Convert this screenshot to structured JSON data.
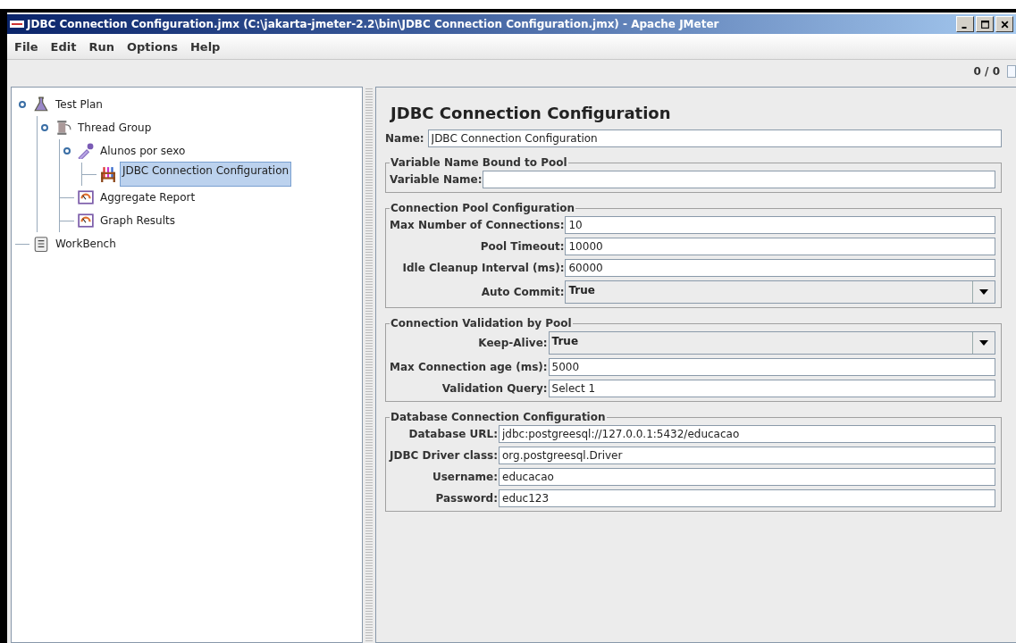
{
  "window": {
    "title": "JDBC Connection Configuration.jmx (C:\\jakarta-jmeter-2.2\\bin\\JDBC Connection Configuration.jmx) - Apache JMeter"
  },
  "menu": [
    {
      "label": "File"
    },
    {
      "label": "Edit"
    },
    {
      "label": "Run"
    },
    {
      "label": "Options"
    },
    {
      "label": "Help"
    }
  ],
  "toolbar": {
    "counter": "0 / 0"
  },
  "tree": [
    {
      "label": "Test Plan",
      "kind": "plan",
      "expanded": true,
      "selected": false,
      "children": [
        {
          "label": "Thread Group",
          "kind": "thread",
          "expanded": true,
          "selected": false,
          "children": [
            {
              "label": "Alunos por sexo",
              "kind": "sampler",
              "expanded": true,
              "selected": false,
              "children": [
                {
                  "label": "JDBC Connection Configuration",
                  "kind": "config",
                  "selected": true
                }
              ]
            },
            {
              "label": "Aggregate Report",
              "kind": "listener",
              "selected": false
            },
            {
              "label": "Graph Results",
              "kind": "listener",
              "selected": false
            }
          ]
        }
      ]
    },
    {
      "label": "WorkBench",
      "kind": "workbench",
      "selected": false
    }
  ],
  "panel": {
    "title": "JDBC Connection Configuration",
    "name_label": "Name:",
    "name_value": "JDBC Connection Configuration",
    "sections": [
      {
        "title": "Variable Name Bound to Pool",
        "fields": [
          {
            "label": "Variable Name:",
            "kind": "text"
          }
        ]
      },
      {
        "title": "Connection Pool Configuration",
        "fields": [
          {
            "label": "Max Number of Connections:",
            "kind": "text",
            "value": "10"
          },
          {
            "label": "Pool Timeout:",
            "kind": "text",
            "value": "10000"
          },
          {
            "label": "Idle Cleanup Interval (ms):",
            "kind": "text",
            "value": "60000"
          },
          {
            "label": "Auto Commit:",
            "kind": "select",
            "value": "True"
          }
        ]
      },
      {
        "title": "Connection Validation by Pool",
        "fields": [
          {
            "label": "Keep-Alive:",
            "kind": "select",
            "value": "True"
          },
          {
            "label": "Max Connection age (ms):",
            "kind": "text",
            "value": "5000"
          },
          {
            "label": "Validation Query:",
            "kind": "text",
            "value": "Select 1"
          }
        ]
      },
      {
        "title": "Database Connection Configuration",
        "fields": [
          {
            "label": "Database URL:",
            "kind": "text",
            "value": "jdbc:postgreesql://127.0.0.1:5432/educacao"
          },
          {
            "label": "JDBC Driver class:",
            "kind": "text",
            "value": "org.postgreesql.Driver"
          },
          {
            "label": "Username:",
            "kind": "text",
            "value": "educacao"
          },
          {
            "label": "Password:",
            "kind": "text",
            "value": "educ123"
          }
        ]
      }
    ]
  }
}
